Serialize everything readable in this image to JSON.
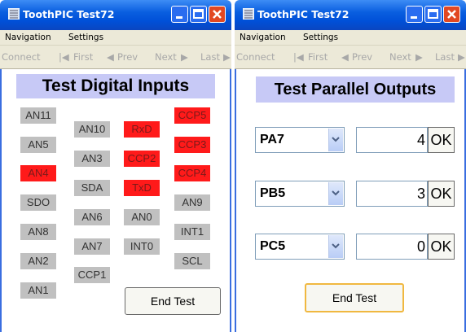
{
  "left": {
    "title": "ToothPIC Test72",
    "menu": {
      "navigation": "Navigation",
      "settings": "Settings"
    },
    "nav": {
      "connect": "Connect",
      "first": "First",
      "prev": "Prev",
      "next": "Next",
      "last": "Last"
    },
    "heading": "Test Digital Inputs",
    "pins": {
      "col1": [
        {
          "label": "AN11",
          "active": false
        },
        {
          "label": "AN5",
          "active": false
        },
        {
          "label": "AN4",
          "active": true
        },
        {
          "label": "SDO",
          "active": false
        },
        {
          "label": "AN8",
          "active": false
        },
        {
          "label": "AN2",
          "active": false
        },
        {
          "label": "AN1",
          "active": false
        }
      ],
      "col2": [
        {
          "label": "AN10",
          "active": false
        },
        {
          "label": "AN3",
          "active": false
        },
        {
          "label": "SDA",
          "active": false
        },
        {
          "label": "AN6",
          "active": false
        },
        {
          "label": "AN7",
          "active": false
        },
        {
          "label": "CCP1",
          "active": false
        }
      ],
      "col3": [
        {
          "label": "RxD",
          "active": true
        },
        {
          "label": "CCP2",
          "active": true
        },
        {
          "label": "TxD",
          "active": true
        },
        {
          "label": "AN0",
          "active": false
        },
        {
          "label": "INT0",
          "active": false
        }
      ],
      "col4": [
        {
          "label": "CCP5",
          "active": true
        },
        {
          "label": "CCP3",
          "active": true
        },
        {
          "label": "CCP4",
          "active": true
        },
        {
          "label": "AN9",
          "active": false
        },
        {
          "label": "INT1",
          "active": false
        },
        {
          "label": "SCL",
          "active": false
        }
      ]
    },
    "end_test": "End Test"
  },
  "right": {
    "title": "ToothPIC Test72",
    "menu": {
      "navigation": "Navigation",
      "settings": "Settings"
    },
    "nav": {
      "connect": "Connect",
      "first": "First",
      "prev": "Prev",
      "next": "Next",
      "last": "Last"
    },
    "heading": "Test Parallel Outputs",
    "outputs": [
      {
        "port": "PA7",
        "value": "4",
        "ok": "OK"
      },
      {
        "port": "PB5",
        "value": "3",
        "ok": "OK"
      },
      {
        "port": "PC5",
        "value": "0",
        "ok": "OK"
      }
    ],
    "end_test": "End Test"
  },
  "colors": {
    "title_bar": "#0a5fe0",
    "active_pin": "#ff1a1a",
    "inactive_pin": "#c0c0c0",
    "heading_bg": "#c7c9f6"
  },
  "icons": {
    "app": "toothpic-app-icon",
    "minimize": "minimize-icon",
    "maximize": "maximize-icon",
    "close": "close-icon",
    "dropdown": "chevron-down-icon"
  }
}
